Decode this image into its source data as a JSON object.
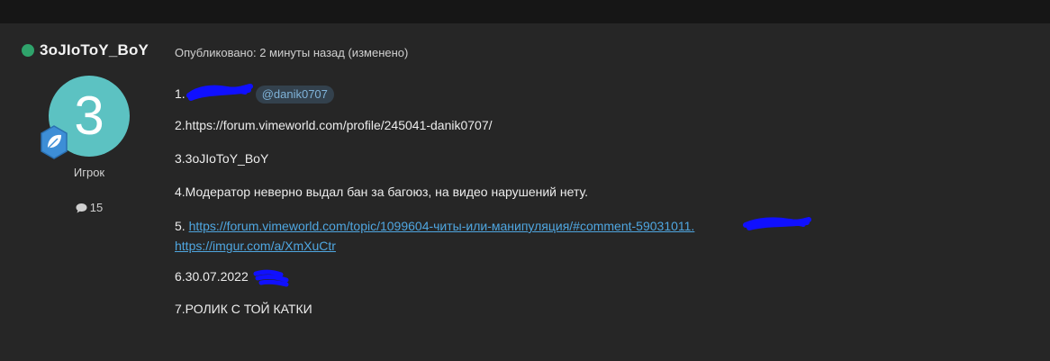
{
  "author": {
    "name": "3oJIoToY_BoY",
    "avatar_letter": "3",
    "role": "Игрок",
    "post_count": "15"
  },
  "post": {
    "meta": "Опубликовано: 2 минуты назад (изменено)",
    "lines": {
      "l1_prefix": "1.",
      "l1_mention": "@danik0707",
      "l2": "2.https://forum.vimeworld.com/profile/245041-danik0707/",
      "l3": "3.3oJIoToY_BoY",
      "l4": "4.Модератор неверно выдал бан за багоюз, на видео нарушений нету.",
      "l5_prefix": "5.",
      "l5_link1": "https://forum.vimeworld.com/topic/1099604-читы-или-манипуляция/#comment-59031011.",
      "l5_link2": "https://imgur.com/a/XmXuCtr",
      "l6": "6.30.07.2022",
      "l7": "7.РОЛИК С ТОЙ КАТКИ"
    }
  },
  "colors": {
    "background": "#262626",
    "online": "#2fa36b",
    "avatar": "#5cc2c2",
    "link": "#4fa6e0",
    "redaction": "#1010ff"
  },
  "icons": {
    "online": "online-status-dot",
    "rank": "leaf-rank-badge-icon",
    "posts": "comment-bubble-icon"
  }
}
